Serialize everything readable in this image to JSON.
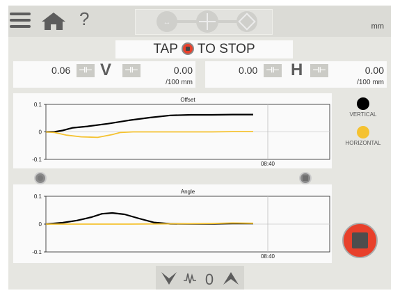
{
  "header": {
    "unit_label": "mm",
    "help_label": "?",
    "icons": [
      "menu-icon",
      "home-icon",
      "help-icon",
      "step-move-icon",
      "step-measure-icon",
      "step-tolerance-icon"
    ]
  },
  "status": {
    "tap_label": "TAP",
    "to_stop_label": "TO STOP"
  },
  "vertical": {
    "left_value": "0.06",
    "axis_letter": "V",
    "right_value": "0.00",
    "unit": "/100 mm"
  },
  "horizontal": {
    "left_value": "0.00",
    "axis_letter": "H",
    "right_value": "0.00",
    "unit": "/100 mm"
  },
  "legend": {
    "vertical_label": "VERTICAL",
    "horizontal_label": "HORIZONTAL",
    "vertical_color": "#000000",
    "horizontal_color": "#f5c230"
  },
  "bottom": {
    "zero_value": "0"
  },
  "chart_data": [
    {
      "type": "line",
      "title": "Offset",
      "ylim": [
        -0.1,
        0.1
      ],
      "yticks": [
        "0.1",
        "0",
        "-0.1"
      ],
      "time_label": "08:40",
      "series": [
        {
          "name": "VERTICAL",
          "color": "#000000",
          "x": [
            0,
            0.04,
            0.08,
            0.13,
            0.2,
            0.3,
            0.4,
            0.5,
            0.6,
            0.7,
            0.8,
            0.9,
            1.0
          ],
          "y": [
            0.0,
            0.0,
            0.005,
            0.015,
            0.02,
            0.03,
            0.042,
            0.052,
            0.06,
            0.062,
            0.062,
            0.063,
            0.063
          ]
        },
        {
          "name": "HORIZONTAL",
          "color": "#f5c230",
          "x": [
            0,
            0.04,
            0.1,
            0.17,
            0.25,
            0.32,
            0.36,
            0.42,
            0.5,
            0.6,
            0.7,
            0.8,
            0.9,
            1.0
          ],
          "y": [
            0.0,
            -0.002,
            -0.012,
            -0.018,
            -0.02,
            -0.01,
            -0.002,
            0.0,
            0.0,
            0.0,
            0.0,
            0.0,
            0.001,
            0.001
          ]
        }
      ]
    },
    {
      "type": "line",
      "title": "Angle",
      "ylim": [
        -0.1,
        0.1
      ],
      "yticks": [
        "0.1",
        "0",
        "-0.1"
      ],
      "time_label": "08:40",
      "series": [
        {
          "name": "VERTICAL",
          "color": "#000000",
          "x": [
            0,
            0.08,
            0.15,
            0.22,
            0.27,
            0.32,
            0.38,
            0.45,
            0.52,
            0.6,
            0.7,
            0.8,
            0.9,
            1.0
          ],
          "y": [
            0.0,
            0.005,
            0.013,
            0.025,
            0.037,
            0.04,
            0.035,
            0.02,
            0.006,
            0.001,
            0.001,
            0.001,
            0.002,
            0.002
          ]
        },
        {
          "name": "HORIZONTAL",
          "color": "#f5c230",
          "x": [
            0,
            0.2,
            0.4,
            0.6,
            0.8,
            0.9,
            1.0
          ],
          "y": [
            0.0,
            0.0,
            0.0,
            0.001,
            0.002,
            0.004,
            0.003
          ]
        }
      ]
    }
  ]
}
